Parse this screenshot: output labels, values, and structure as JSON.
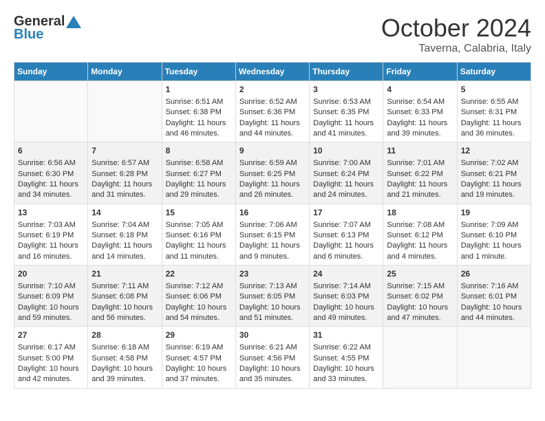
{
  "header": {
    "logo_general": "General",
    "logo_blue": "Blue",
    "month": "October 2024",
    "location": "Taverna, Calabria, Italy"
  },
  "weekdays": [
    "Sunday",
    "Monday",
    "Tuesday",
    "Wednesday",
    "Thursday",
    "Friday",
    "Saturday"
  ],
  "weeks": [
    [
      {
        "day": "",
        "sunrise": "",
        "sunset": "",
        "daylight": ""
      },
      {
        "day": "",
        "sunrise": "",
        "sunset": "",
        "daylight": ""
      },
      {
        "day": "1",
        "sunrise": "Sunrise: 6:51 AM",
        "sunset": "Sunset: 6:38 PM",
        "daylight": "Daylight: 11 hours and 46 minutes."
      },
      {
        "day": "2",
        "sunrise": "Sunrise: 6:52 AM",
        "sunset": "Sunset: 6:36 PM",
        "daylight": "Daylight: 11 hours and 44 minutes."
      },
      {
        "day": "3",
        "sunrise": "Sunrise: 6:53 AM",
        "sunset": "Sunset: 6:35 PM",
        "daylight": "Daylight: 11 hours and 41 minutes."
      },
      {
        "day": "4",
        "sunrise": "Sunrise: 6:54 AM",
        "sunset": "Sunset: 6:33 PM",
        "daylight": "Daylight: 11 hours and 39 minutes."
      },
      {
        "day": "5",
        "sunrise": "Sunrise: 6:55 AM",
        "sunset": "Sunset: 6:31 PM",
        "daylight": "Daylight: 11 hours and 36 minutes."
      }
    ],
    [
      {
        "day": "6",
        "sunrise": "Sunrise: 6:56 AM",
        "sunset": "Sunset: 6:30 PM",
        "daylight": "Daylight: 11 hours and 34 minutes."
      },
      {
        "day": "7",
        "sunrise": "Sunrise: 6:57 AM",
        "sunset": "Sunset: 6:28 PM",
        "daylight": "Daylight: 11 hours and 31 minutes."
      },
      {
        "day": "8",
        "sunrise": "Sunrise: 6:58 AM",
        "sunset": "Sunset: 6:27 PM",
        "daylight": "Daylight: 11 hours and 29 minutes."
      },
      {
        "day": "9",
        "sunrise": "Sunrise: 6:59 AM",
        "sunset": "Sunset: 6:25 PM",
        "daylight": "Daylight: 11 hours and 26 minutes."
      },
      {
        "day": "10",
        "sunrise": "Sunrise: 7:00 AM",
        "sunset": "Sunset: 6:24 PM",
        "daylight": "Daylight: 11 hours and 24 minutes."
      },
      {
        "day": "11",
        "sunrise": "Sunrise: 7:01 AM",
        "sunset": "Sunset: 6:22 PM",
        "daylight": "Daylight: 11 hours and 21 minutes."
      },
      {
        "day": "12",
        "sunrise": "Sunrise: 7:02 AM",
        "sunset": "Sunset: 6:21 PM",
        "daylight": "Daylight: 11 hours and 19 minutes."
      }
    ],
    [
      {
        "day": "13",
        "sunrise": "Sunrise: 7:03 AM",
        "sunset": "Sunset: 6:19 PM",
        "daylight": "Daylight: 11 hours and 16 minutes."
      },
      {
        "day": "14",
        "sunrise": "Sunrise: 7:04 AM",
        "sunset": "Sunset: 6:18 PM",
        "daylight": "Daylight: 11 hours and 14 minutes."
      },
      {
        "day": "15",
        "sunrise": "Sunrise: 7:05 AM",
        "sunset": "Sunset: 6:16 PM",
        "daylight": "Daylight: 11 hours and 11 minutes."
      },
      {
        "day": "16",
        "sunrise": "Sunrise: 7:06 AM",
        "sunset": "Sunset: 6:15 PM",
        "daylight": "Daylight: 11 hours and 9 minutes."
      },
      {
        "day": "17",
        "sunrise": "Sunrise: 7:07 AM",
        "sunset": "Sunset: 6:13 PM",
        "daylight": "Daylight: 11 hours and 6 minutes."
      },
      {
        "day": "18",
        "sunrise": "Sunrise: 7:08 AM",
        "sunset": "Sunset: 6:12 PM",
        "daylight": "Daylight: 11 hours and 4 minutes."
      },
      {
        "day": "19",
        "sunrise": "Sunrise: 7:09 AM",
        "sunset": "Sunset: 6:10 PM",
        "daylight": "Daylight: 11 hours and 1 minute."
      }
    ],
    [
      {
        "day": "20",
        "sunrise": "Sunrise: 7:10 AM",
        "sunset": "Sunset: 6:09 PM",
        "daylight": "Daylight: 10 hours and 59 minutes."
      },
      {
        "day": "21",
        "sunrise": "Sunrise: 7:11 AM",
        "sunset": "Sunset: 6:08 PM",
        "daylight": "Daylight: 10 hours and 56 minutes."
      },
      {
        "day": "22",
        "sunrise": "Sunrise: 7:12 AM",
        "sunset": "Sunset: 6:06 PM",
        "daylight": "Daylight: 10 hours and 54 minutes."
      },
      {
        "day": "23",
        "sunrise": "Sunrise: 7:13 AM",
        "sunset": "Sunset: 6:05 PM",
        "daylight": "Daylight: 10 hours and 51 minutes."
      },
      {
        "day": "24",
        "sunrise": "Sunrise: 7:14 AM",
        "sunset": "Sunset: 6:03 PM",
        "daylight": "Daylight: 10 hours and 49 minutes."
      },
      {
        "day": "25",
        "sunrise": "Sunrise: 7:15 AM",
        "sunset": "Sunset: 6:02 PM",
        "daylight": "Daylight: 10 hours and 47 minutes."
      },
      {
        "day": "26",
        "sunrise": "Sunrise: 7:16 AM",
        "sunset": "Sunset: 6:01 PM",
        "daylight": "Daylight: 10 hours and 44 minutes."
      }
    ],
    [
      {
        "day": "27",
        "sunrise": "Sunrise: 6:17 AM",
        "sunset": "Sunset: 5:00 PM",
        "daylight": "Daylight: 10 hours and 42 minutes."
      },
      {
        "day": "28",
        "sunrise": "Sunrise: 6:18 AM",
        "sunset": "Sunset: 4:58 PM",
        "daylight": "Daylight: 10 hours and 39 minutes."
      },
      {
        "day": "29",
        "sunrise": "Sunrise: 6:19 AM",
        "sunset": "Sunset: 4:57 PM",
        "daylight": "Daylight: 10 hours and 37 minutes."
      },
      {
        "day": "30",
        "sunrise": "Sunrise: 6:21 AM",
        "sunset": "Sunset: 4:56 PM",
        "daylight": "Daylight: 10 hours and 35 minutes."
      },
      {
        "day": "31",
        "sunrise": "Sunrise: 6:22 AM",
        "sunset": "Sunset: 4:55 PM",
        "daylight": "Daylight: 10 hours and 33 minutes."
      },
      {
        "day": "",
        "sunrise": "",
        "sunset": "",
        "daylight": ""
      },
      {
        "day": "",
        "sunrise": "",
        "sunset": "",
        "daylight": ""
      }
    ]
  ]
}
